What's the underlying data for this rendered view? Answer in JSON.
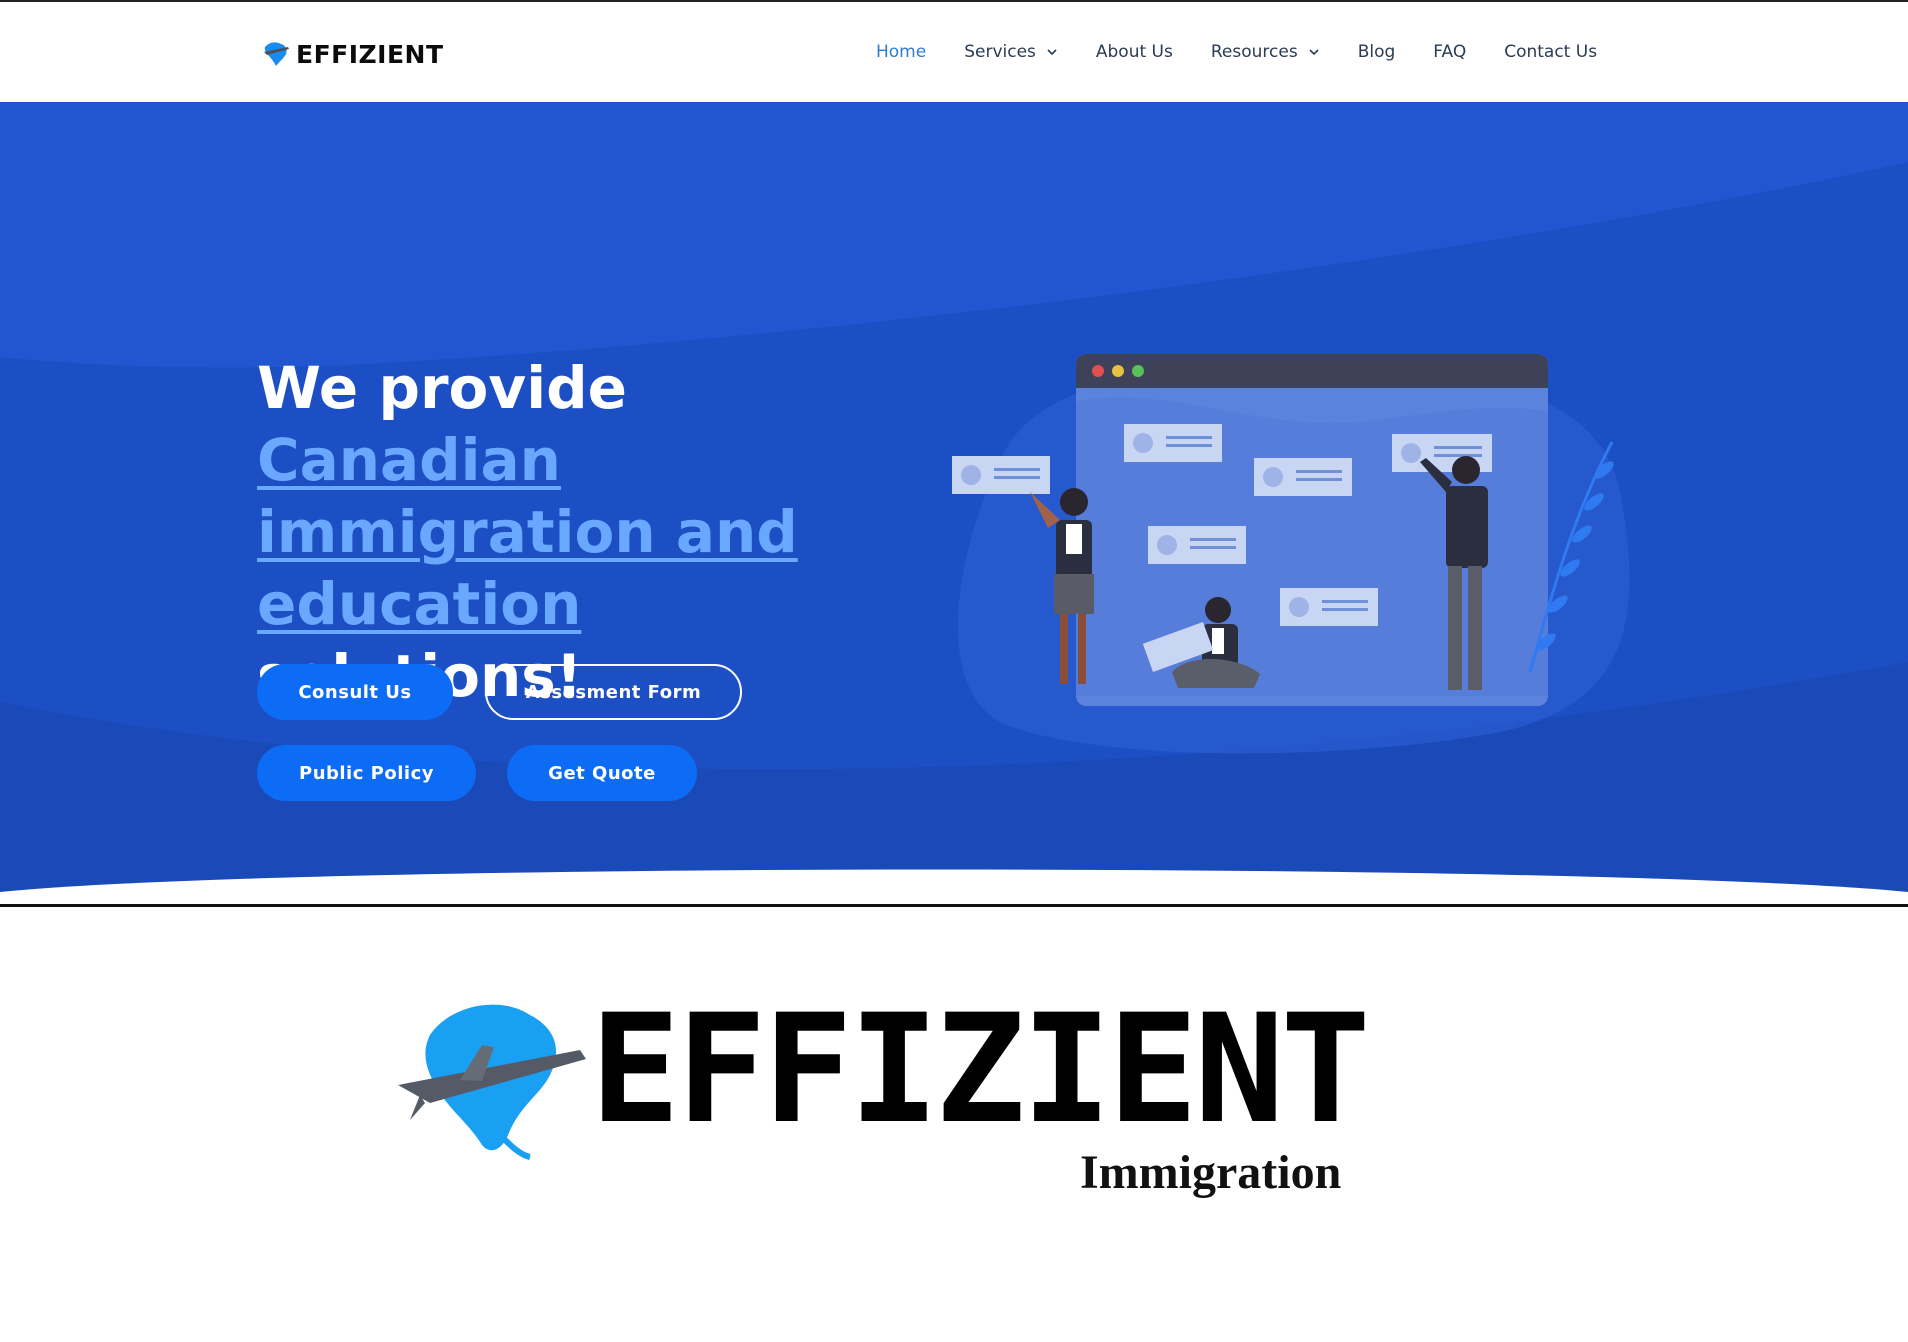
{
  "brand": {
    "name": "EFFIZIENT",
    "tagline": "Immigration"
  },
  "nav": {
    "items": [
      {
        "label": "Home",
        "active": true,
        "dropdown": false
      },
      {
        "label": "Services",
        "active": false,
        "dropdown": true
      },
      {
        "label": "About Us",
        "active": false,
        "dropdown": false
      },
      {
        "label": "Resources",
        "active": false,
        "dropdown": true
      },
      {
        "label": "Blog",
        "active": false,
        "dropdown": false
      },
      {
        "label": "FAQ",
        "active": false,
        "dropdown": false
      },
      {
        "label": "Contact Us",
        "active": false,
        "dropdown": false
      }
    ]
  },
  "hero": {
    "line1": "We provide",
    "highlight1": "Canadian",
    "highlight2": "immigration and",
    "highlight3": "education",
    "line_end": "solutions!",
    "buttons": {
      "consult": "Consult Us",
      "assessment": "Assesment Form",
      "policy": "Public Policy",
      "quote": "Get Quote"
    }
  },
  "colors": {
    "hero_bg": "#1c4fc4",
    "accent": "#0c6cf5",
    "highlight_text": "#6aa8ff",
    "nav_active": "#2e7ad1"
  },
  "icons": {
    "logo": "globe-airplane-icon",
    "dropdown": "chevron-down-icon"
  }
}
